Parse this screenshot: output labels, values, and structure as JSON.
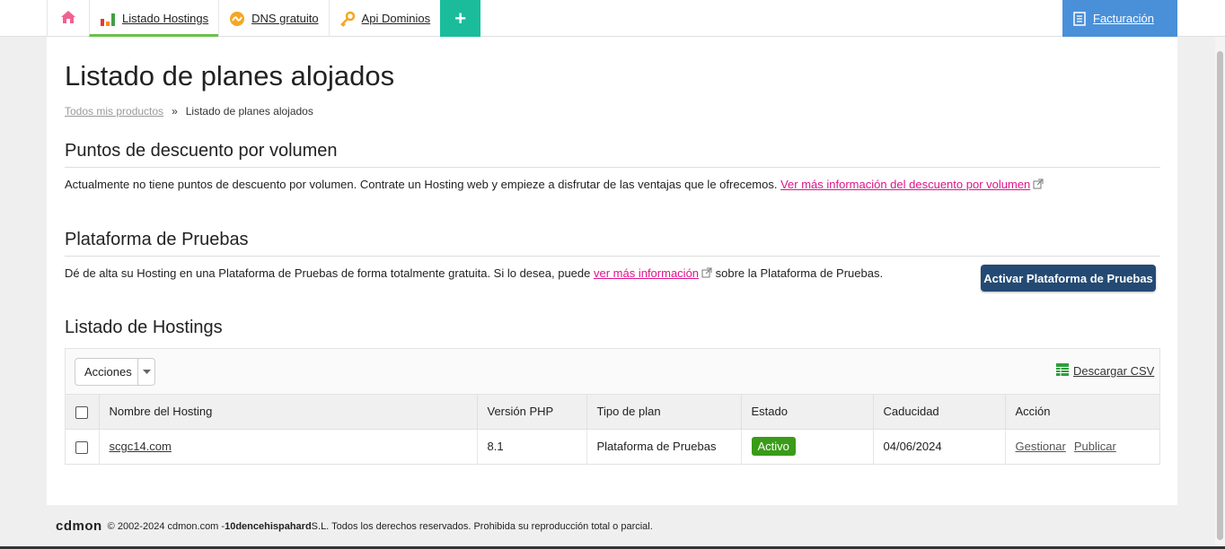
{
  "nav": {
    "items": [
      {
        "label": "Listado Hostings"
      },
      {
        "label": "DNS gratuito"
      },
      {
        "label": "Api Dominios"
      }
    ],
    "plus_label": "+",
    "billing_label": "Facturación"
  },
  "page": {
    "title": "Listado de planes alojados",
    "breadcrumb": {
      "root": "Todos mis productos",
      "separator": "»",
      "current": "Listado de planes alojados"
    }
  },
  "discount": {
    "title": "Puntos de descuento por volumen",
    "text": "Actualmente no tiene puntos de descuento por volumen. Contrate un Hosting web y empieze a disfrutar de las ventajas que le ofrecemos. ",
    "link": "Ver más información del descuento por volumen"
  },
  "testing": {
    "title": "Plataforma de Pruebas",
    "text_before": "Dé de alta su Hosting en una Plataforma de Pruebas de forma totalmente gratuita. Si lo desea, puede ",
    "link": "ver más información",
    "text_after": " sobre la Plataforma de Pruebas.",
    "button": "Activar Plataforma de Pruebas"
  },
  "hostings": {
    "title": "Listado de Hostings",
    "actions_label": "Acciones",
    "csv_label": "Descargar CSV",
    "columns": [
      "Nombre del Hosting",
      "Versión PHP",
      "Tipo de plan",
      "Estado",
      "Caducidad",
      "Acción"
    ],
    "rows": [
      {
        "name": "scgc14.com",
        "php": "8.1",
        "plan": "Plataforma de Pruebas",
        "status": "Activo",
        "expiry": "04/06/2024",
        "action_manage": "Gestionar",
        "action_publish": "Publicar"
      }
    ]
  },
  "footer": {
    "logo": "cdmon",
    "text_before": "© 2002-2024 cdmon.com - ",
    "company": "10dencehispahard",
    "text_after": " S.L. Todos los derechos reservados. Prohibida su reproducción total o parcial."
  },
  "colors": {
    "accent_green": "#6cc04a",
    "plus_teal": "#1abc9c",
    "billing_blue": "#4a90d9",
    "link_pink": "#e0148c",
    "button_navy": "#244a73",
    "status_green": "#3a9b18"
  }
}
